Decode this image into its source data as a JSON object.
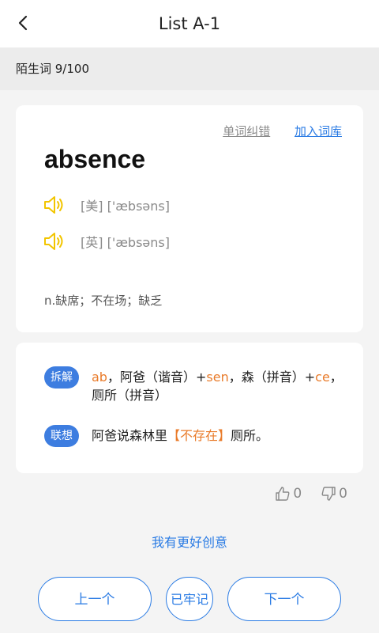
{
  "header": {
    "title": "List A-1",
    "back_icon": "chevron-left-icon"
  },
  "progress": {
    "label": "陌生词 9/100"
  },
  "word_card": {
    "correct_link": "单词纠错",
    "add_link": "加入词库",
    "word": "absence",
    "pron_us": "[美] ['æbsəns]",
    "pron_uk": "[英] ['æbsəns]",
    "meaning": "n.缺席；不在场；缺乏",
    "speaker_color": "#f2c500"
  },
  "memory": {
    "split_tag": "拆解",
    "split_parts": {
      "p1": "ab",
      "p2": "，阿爸（谐音）+",
      "p3": "sen",
      "p4": "，森（拼音）+",
      "p5": "ce",
      "p6": "，厕所（拼音）"
    },
    "assoc_tag": "联想",
    "assoc_parts": {
      "a1": "阿爸说森林里",
      "a2": "【不存在】",
      "a3": "厕所。"
    }
  },
  "reactions": {
    "like_count": "0",
    "dislike_count": "0"
  },
  "better_idea": "我有更好创意",
  "buttons": {
    "prev": "上一个",
    "memorized": "已牢记",
    "next": "下一个"
  },
  "colors": {
    "accent": "#2a7be4",
    "tag": "#3d7de0",
    "highlight": "#e97b2a",
    "speaker": "#f2c500"
  }
}
